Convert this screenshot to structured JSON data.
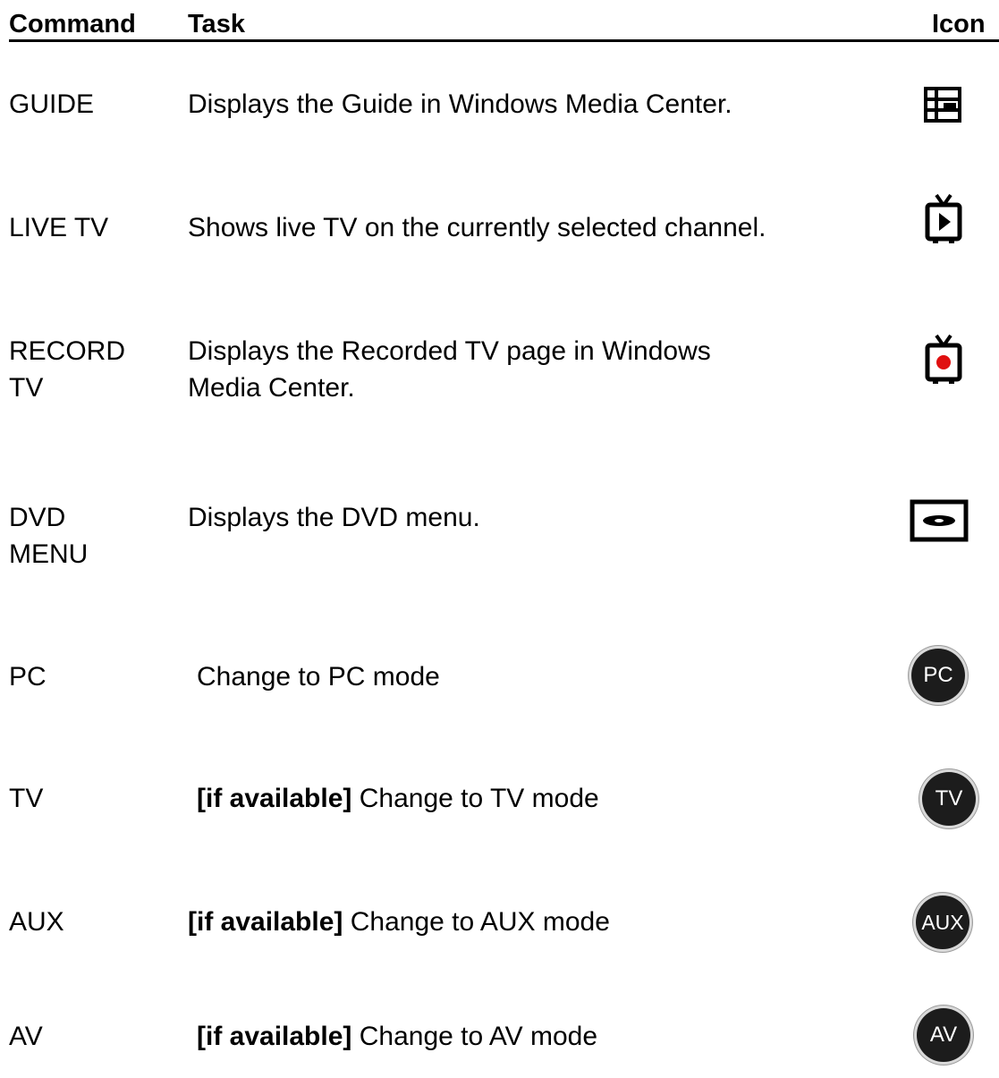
{
  "header": {
    "command": "Command",
    "task": "Task",
    "icon": "Icon"
  },
  "rows": [
    {
      "command_lines": [
        "GUIDE"
      ],
      "task_lines": [
        "Displays the Guide in Windows Media Center."
      ],
      "icon": "guide-grid-icon"
    },
    {
      "command_lines": [
        "LIVE TV"
      ],
      "task_lines": [
        "Shows live TV on the currently selected channel."
      ],
      "icon": "live-tv-icon"
    },
    {
      "command_lines": [
        "RECORD",
        "TV"
      ],
      "task_lines": [
        "Displays the Recorded TV page in Windows",
        "Media Center."
      ],
      "icon": "recorded-tv-icon"
    },
    {
      "command_lines": [
        "DVD",
        "MENU"
      ],
      "task_lines": [
        "Displays the DVD menu."
      ],
      "icon": "dvd-menu-icon"
    },
    {
      "command_lines": [
        "PC"
      ],
      "task_prefix": "",
      "task_text": "Change to PC mode",
      "icon": "pc-button-icon",
      "icon_label": "PC"
    },
    {
      "command_lines": [
        "TV"
      ],
      "task_prefix": "[if available]",
      "task_text": " Change to TV mode",
      "icon": "tv-button-icon",
      "icon_label": "TV"
    },
    {
      "command_lines": [
        "AUX"
      ],
      "task_prefix": "[if available]",
      "task_text": " Change to AUX mode",
      "icon": "aux-button-icon",
      "icon_label": "AUX"
    },
    {
      "command_lines": [
        "AV"
      ],
      "task_prefix": "[if available]",
      "task_text": " Change to AV mode",
      "icon": "av-button-icon",
      "icon_label": "AV"
    }
  ],
  "colors": {
    "text": "#000000",
    "button_fill": "#1c1c1c",
    "record_dot": "#e01010"
  }
}
